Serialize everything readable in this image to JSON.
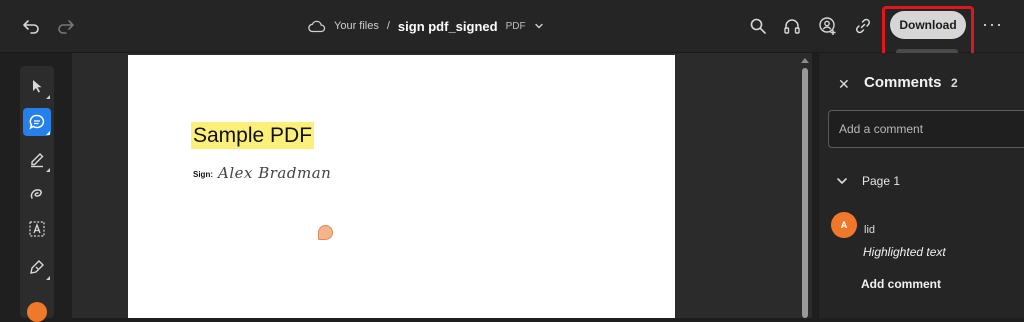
{
  "header": {
    "breadcrumb_root": "Your files",
    "breadcrumb_sep": "/",
    "file_name": "sign pdf_signed",
    "file_type": "PDF",
    "download_label": "Download",
    "download_tooltip": "Download",
    "more_label": "···",
    "icons": [
      "undo-icon",
      "redo-icon",
      "cloud-icon",
      "chevron-down-icon",
      "search-icon",
      "headphones-icon",
      "share-user-icon",
      "link-icon"
    ]
  },
  "toolbar": {
    "tools": [
      "select-tool",
      "comment-tool",
      "highlight-tool",
      "draw-tool",
      "text-tool",
      "sign-tool"
    ],
    "active_tool": "comment-tool",
    "color": "#f0782a"
  },
  "document": {
    "title": "Sample PDF",
    "sign_label": "Sign:",
    "signature": "Alex Bradman",
    "highlight_color": "#fdf07a"
  },
  "comments_panel": {
    "title": "Comments",
    "count": "2",
    "input_placeholder": "Add a comment",
    "group_label": "Page 1",
    "comment": {
      "avatar_initial": "A",
      "author": "lid",
      "text": "Highlighted text",
      "action": "Add comment"
    }
  },
  "colors": {
    "accent": "#2680eb",
    "annotation_red": "#e0161f",
    "avatar": "#f0782a"
  }
}
